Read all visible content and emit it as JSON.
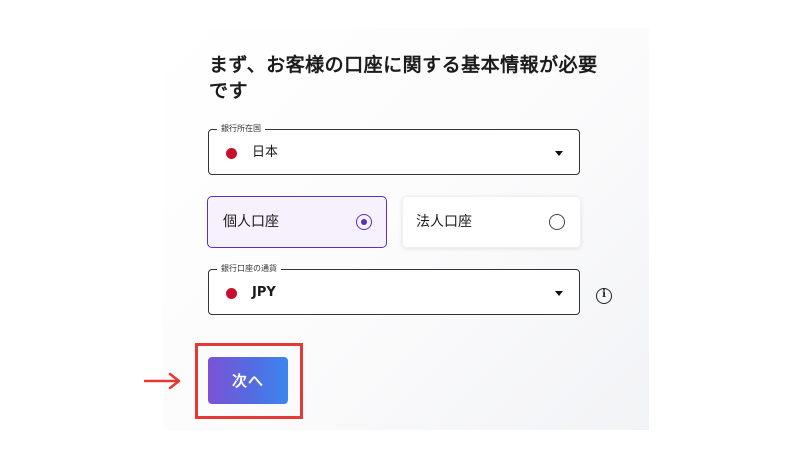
{
  "form": {
    "title": "まず、お客様の口座に関する基本情報が必要です",
    "bank_country": {
      "label": "銀行所在国",
      "value": "日本"
    },
    "account_type": {
      "options": [
        {
          "label": "個人口座",
          "selected": true
        },
        {
          "label": "法人口座",
          "selected": false
        }
      ]
    },
    "currency": {
      "label": "銀行口座の通貨",
      "value": "JPY"
    },
    "next_button": "次へ"
  },
  "colors": {
    "accent": "#5b2fb8",
    "selected_bg": "#f6f1fd",
    "button_gradient_start": "#7b52d6",
    "button_gradient_end": "#3d86ef",
    "flag_red": "#c8102e",
    "annotation_red": "#e53935"
  },
  "icons": {
    "info": "info-circle-icon",
    "dropdown": "caret-down-icon",
    "flag": "japan-flag-icon",
    "annotation": "arrow-right-icon"
  }
}
